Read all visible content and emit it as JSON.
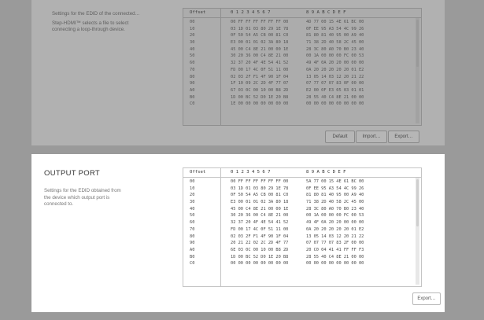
{
  "input_port": {
    "description": [
      "Settings for the EDID of the connected…",
      "Step-HDMI™ selects a file to select",
      "connecting a loop-through device."
    ],
    "hex_header": {
      "offset": "Offset",
      "cols1": "0 1 2 3 4 5 6 7",
      "cols2": "8 9 A B C D E F"
    },
    "rows": [
      {
        "off": "00",
        "b1": "00 FF FF FF FF FF FF 00",
        "b2": "4D 77 00 15 4E 61 BC 00"
      },
      {
        "off": "10",
        "b1": "03 1D 01 03 80 29 1E 78",
        "b2": "0F EE 95 A3 54 4C 99 26"
      },
      {
        "off": "20",
        "b1": "0F 50 54 A5 CB 00 81 C0",
        "b2": "81 80 81 40 95 00 A9 40"
      },
      {
        "off": "30",
        "b1": "E3 00 01 01 02 3A 80 18",
        "b2": "71 38 2D 40 58 2C 45 00"
      },
      {
        "off": "40",
        "b1": "45 00 C4 8E 21 00 00 1E",
        "b2": "28 3C 80 A0 70 B0 23 40"
      },
      {
        "off": "50",
        "b1": "30 20 36 00 C4 8E 21 00",
        "b2": "00 1A 00 00 00 FC 00 53"
      },
      {
        "off": "60",
        "b1": "32 37 20 4F 4E 54 41 52",
        "b2": "49 4F 0A 20 20 00 00 00"
      },
      {
        "off": "70",
        "b1": "FD 00 17 4C 0F 51 11 00",
        "b2": "0A 20 20 20 20 20 01 E2"
      },
      {
        "off": "80",
        "b1": "02 03 2F F1 4F 90 1F 04",
        "b2": "13 05 14 03 12 20 21 22"
      },
      {
        "off": "90",
        "b1": "1F 10 09 2C 2D 4F 77 07",
        "b2": "07 77 07 07 83 0F 00 00"
      },
      {
        "off": "A0",
        "b1": "67 03 0C 00 10 00 B8 2D",
        "b2": "E2 00 0F E3 05 03 01 01"
      },
      {
        "off": "B0",
        "b1": "1D 00 BC 52 D0 1E 20 B8",
        "b2": "28 55 40 C4 8E 21 00 00"
      },
      {
        "off": "C0",
        "b1": "1E 00 00 00 00 00 00 00",
        "b2": "00 00 00 00 00 00 00 00"
      }
    ],
    "buttons": {
      "default": "Default",
      "import": "Import…",
      "export": "Export…"
    }
  },
  "output_port": {
    "title": "OUTPUT PORT",
    "description": [
      "Settings for the EDID obtained from",
      "the device which output port is",
      "connected to."
    ],
    "hex_header": {
      "offset": "Offset",
      "cols1": "0 1 2 3 4 5 6 7",
      "cols2": "8 9 A B C D E F"
    },
    "rows": [
      {
        "off": "00",
        "b1": "00 FF FF FF FF FF FF 00",
        "b2": "5A 77 00 15 4E 61 BC 00"
      },
      {
        "off": "10",
        "b1": "03 1D 01 03 80 29 1E 78",
        "b2": "0F EE 95 A3 54 4C 99 26"
      },
      {
        "off": "20",
        "b1": "0F 50 54 A5 CB 00 81 C0",
        "b2": "81 80 81 40 95 00 A9 40"
      },
      {
        "off": "30",
        "b1": "E3 00 01 01 02 3A 80 18",
        "b2": "71 38 2D 40 58 2C 45 00"
      },
      {
        "off": "40",
        "b1": "45 00 C4 8E 21 00 00 1E",
        "b2": "28 3C 80 A0 70 B0 23 40"
      },
      {
        "off": "50",
        "b1": "30 20 36 00 C4 8E 21 00",
        "b2": "00 1A 00 00 00 FC 00 53"
      },
      {
        "off": "60",
        "b1": "32 37 20 4F 4E 54 41 52",
        "b2": "49 4F 0A 20 20 00 00 00"
      },
      {
        "off": "70",
        "b1": "FD 00 17 4C 0F 51 11 00",
        "b2": "0A 20 20 20 20 20 01 E2"
      },
      {
        "off": "80",
        "b1": "02 03 2F F1 4F 90 1F 04",
        "b2": "13 05 14 03 12 20 21 22"
      },
      {
        "off": "90",
        "b1": "20 21 22 02 2C 2D 4F 77",
        "b2": "07 07 77 07 83 2F 00 00"
      },
      {
        "off": "A0",
        "b1": "6E 03 0C 00 10 00 B8 2D",
        "b2": "20 C0 04 41 41 FF FF F3"
      },
      {
        "off": "B0",
        "b1": "1D 00 BC 52 D0 1E 20 B8",
        "b2": "28 55 40 C4 8E 21 00 00"
      },
      {
        "off": "C0",
        "b1": "00 00 00 00 00 00 00 00",
        "b2": "00 00 00 00 00 00 00 00"
      }
    ],
    "buttons": {
      "export": "Export…"
    }
  }
}
